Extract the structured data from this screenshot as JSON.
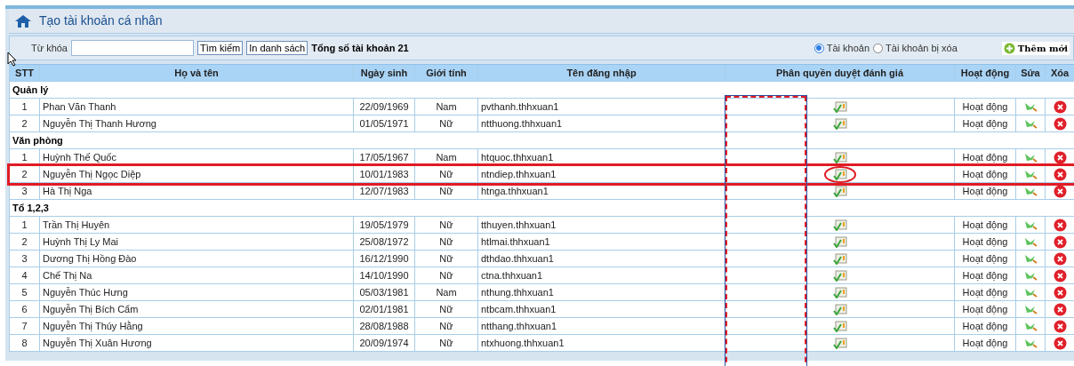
{
  "title": "Tạo tài khoản cá nhân",
  "toolbar": {
    "keyword_label": "Từ khóa",
    "search_button": "Tìm kiếm",
    "print_button": "In danh sách",
    "total": "Tổng số tài khoản 21",
    "radios": [
      {
        "label": "Tài khoản",
        "selected": true
      },
      {
        "label": "Tài khoản bị xóa",
        "selected": false
      }
    ],
    "add_button": "Thêm mới"
  },
  "columns": [
    "STT",
    "Họ và tên",
    "Ngày sinh",
    "Giới tính",
    "Tên đăng nhập",
    "Phân quyền duyệt đánh giá",
    "Hoạt động",
    "Sửa",
    "Xóa"
  ],
  "selection_frame": true,
  "rows": [
    {
      "kind": "group",
      "label": "Quản lý"
    },
    {
      "kind": "person",
      "stt": "1",
      "name": "Phan Văn Thanh",
      "dob": "22/09/1969",
      "gender": "Nam",
      "login": "pvthanh.thhxuan1",
      "status": "Hoạt động",
      "highlighted": false,
      "circled": false
    },
    {
      "kind": "person",
      "stt": "2",
      "name": "Nguyễn Thị Thanh Hương",
      "dob": "01/05/1971",
      "gender": "Nữ",
      "login": "ntthuong.thhxuan1",
      "status": "Hoạt động",
      "highlighted": false,
      "circled": false
    },
    {
      "kind": "group",
      "label": "Văn phòng"
    },
    {
      "kind": "person",
      "stt": "1",
      "name": "Huỳnh Thế Quốc",
      "dob": "17/05/1967",
      "gender": "Nam",
      "login": "htquoc.thhxuan1",
      "status": "Hoạt động",
      "highlighted": false,
      "circled": false
    },
    {
      "kind": "person",
      "stt": "2",
      "name": "Nguyễn Thị Ngọc Diệp",
      "dob": "10/01/1983",
      "gender": "Nữ",
      "login": "ntndiep.thhxuan1",
      "status": "Hoạt động",
      "highlighted": true,
      "circled": true
    },
    {
      "kind": "person",
      "stt": "3",
      "name": "Hà Thị Nga",
      "dob": "12/07/1983",
      "gender": "Nữ",
      "login": "htnga.thhxuan1",
      "status": "Hoạt động",
      "highlighted": false,
      "circled": false
    },
    {
      "kind": "group",
      "label": "Tổ 1,2,3"
    },
    {
      "kind": "person",
      "stt": "1",
      "name": "Trần Thị Huyên",
      "dob": "19/05/1979",
      "gender": "Nữ",
      "login": "tthuyen.thhxuan1",
      "status": "Hoạt động",
      "highlighted": false,
      "circled": false
    },
    {
      "kind": "person",
      "stt": "2",
      "name": "Huỳnh Thị Ly Mai",
      "dob": "25/08/1972",
      "gender": "Nữ",
      "login": "htlmai.thhxuan1",
      "status": "Hoạt động",
      "highlighted": false,
      "circled": false
    },
    {
      "kind": "person",
      "stt": "3",
      "name": "Dương Thị Hồng Đào",
      "dob": "16/12/1990",
      "gender": "Nữ",
      "login": "dthdao.thhxuan1",
      "status": "Hoạt động",
      "highlighted": false,
      "circled": false
    },
    {
      "kind": "person",
      "stt": "4",
      "name": "Chế Thị Na",
      "dob": "14/10/1990",
      "gender": "Nữ",
      "login": "ctna.thhxuan1",
      "status": "Hoạt động",
      "highlighted": false,
      "circled": false
    },
    {
      "kind": "person",
      "stt": "5",
      "name": "Nguyễn Thúc Hưng",
      "dob": "05/03/1981",
      "gender": "Nam",
      "login": "nthung.thhxuan1",
      "status": "Hoạt động",
      "highlighted": false,
      "circled": false
    },
    {
      "kind": "person",
      "stt": "6",
      "name": "Nguyễn Thị Bích Cẩm",
      "dob": "02/01/1981",
      "gender": "Nữ",
      "login": "ntbcam.thhxuan1",
      "status": "Hoạt động",
      "highlighted": false,
      "circled": false
    },
    {
      "kind": "person",
      "stt": "7",
      "name": "Nguyễn Thị Thúy Hằng",
      "dob": "28/08/1988",
      "gender": "Nữ",
      "login": "ntthang.thhxuan1",
      "status": "Hoạt động",
      "highlighted": false,
      "circled": false
    },
    {
      "kind": "person",
      "stt": "8",
      "name": "Nguyễn Thị Xuân Hương",
      "dob": "20/09/1974",
      "gender": "Nữ",
      "login": "ntxhuong.thhxuan1",
      "status": "Hoạt động",
      "highlighted": false,
      "circled": false
    }
  ]
}
